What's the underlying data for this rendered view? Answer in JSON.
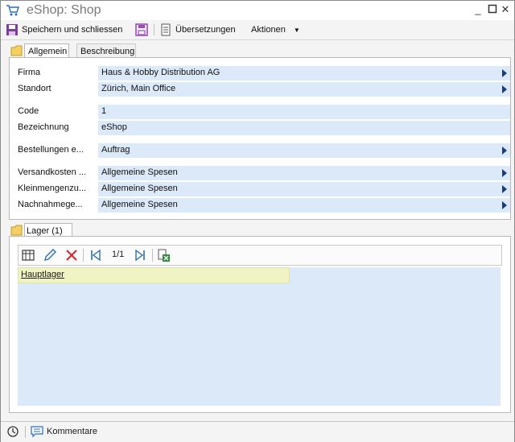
{
  "window": {
    "title": "eShop: Shop",
    "app_icon": "shopping-cart-icon",
    "controls": [
      "minimize-icon",
      "maximize-icon",
      "close-icon"
    ]
  },
  "toolbar": {
    "save_close_label": "Speichern und schliessen",
    "translations_label": "Übersetzungen",
    "actions_label": "Aktionen"
  },
  "tabs": [
    {
      "label": "Allgemein",
      "active": true
    },
    {
      "label": "Beschreibung",
      "active": false
    }
  ],
  "form": {
    "firma": {
      "label": "Firma",
      "value": "Haus & Hobby Distribution AG"
    },
    "standort": {
      "label": "Standort",
      "value": "Zürich, Main Office"
    },
    "code": {
      "label": "Code",
      "value": "1"
    },
    "bezeichnung": {
      "label": "Bezeichnung",
      "value": "eShop"
    },
    "bestellungen": {
      "label": "Bestellungen e...",
      "value": "Auftrag"
    },
    "versandkosten": {
      "label": "Versandkosten ...",
      "value": "Allgemeine Spesen"
    },
    "kleinmengen": {
      "label": "Kleinmengenzu...",
      "value": "Allgemeine Spesen"
    },
    "nachnahme": {
      "label": "Nachnahmege...",
      "value": "Allgemeine Spesen"
    }
  },
  "lager": {
    "section_label": "Lager (1)",
    "pager": "1/1",
    "rows": [
      "Hauptlager"
    ]
  },
  "status": {
    "comments_label": "Kommentare"
  },
  "colors": {
    "field_bg": "#dce9f9",
    "arrow": "#1d3b78",
    "selected_row": "#f0f3c4",
    "delete_red": "#d8252a"
  }
}
